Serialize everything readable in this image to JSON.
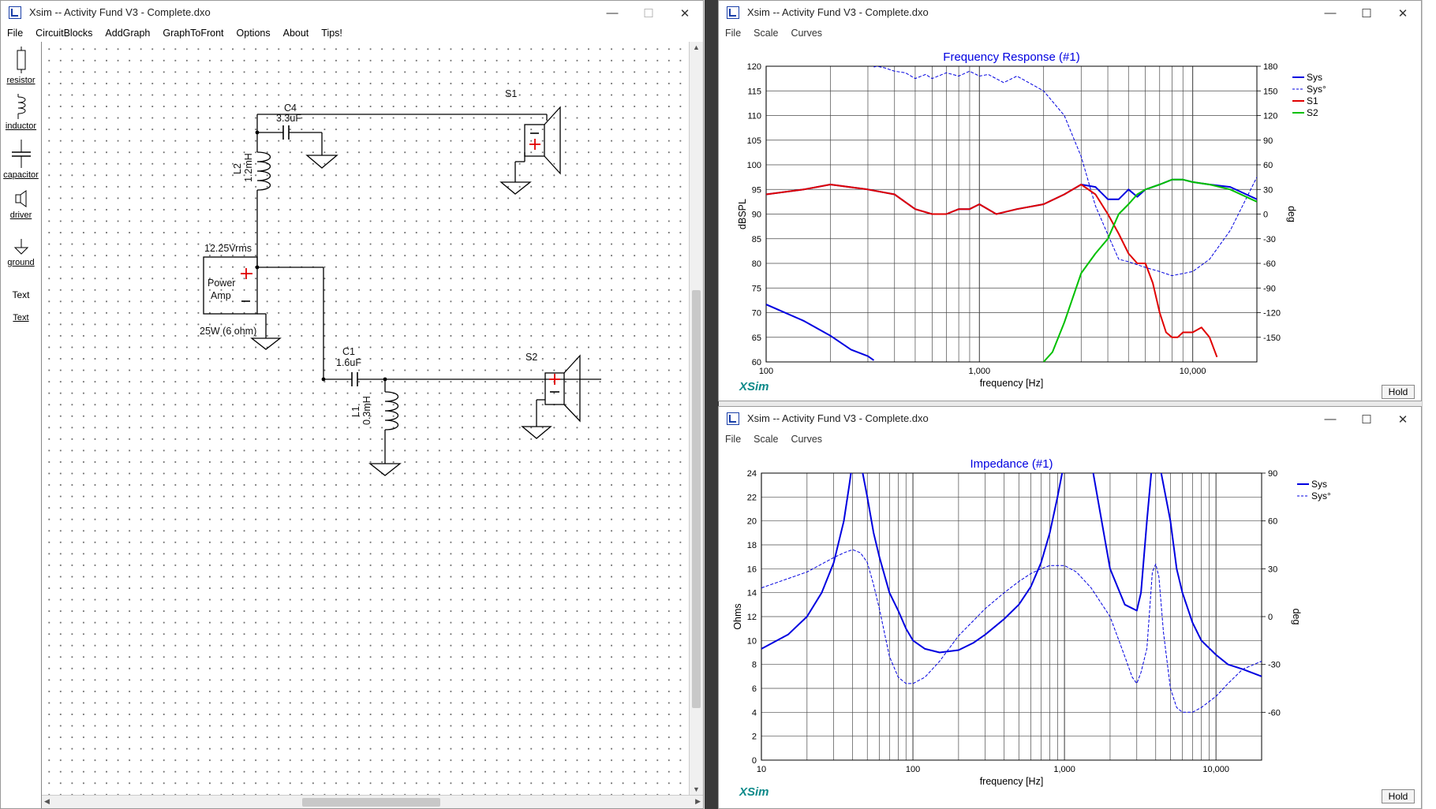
{
  "schematic_window": {
    "title": "Xsim -- Activity Fund V3 - Complete.dxo",
    "menu": [
      "File",
      "CircuitBlocks",
      "AddGraph",
      "GraphToFront",
      "Options",
      "About",
      "Tips!"
    ],
    "tools": [
      "resistor",
      "inductor",
      "capacitor",
      "driver",
      "ground",
      "Text",
      "Text"
    ],
    "components": {
      "c4_name": "C4",
      "c4_value": "3.3uF",
      "l2_name": "L2",
      "l2_value": "1.2mH",
      "c1_name": "C1",
      "c1_value": "1.6uF",
      "l1_name": "L1",
      "l1_value": "0.3mH",
      "s1_name": "S1",
      "s2_name": "S2",
      "amp_voltage": "12.25Vrms",
      "amp_line1": "Power",
      "amp_line2": "Amp",
      "amp_power": "25W (6 ohm)"
    }
  },
  "fr_window": {
    "title": "Xsim -- Activity Fund V3 - Complete.dxo",
    "menu": [
      "File",
      "Scale",
      "Curves"
    ],
    "hold_label": "Hold",
    "logo": "XSim"
  },
  "imp_window": {
    "title": "Xsim -- Activity Fund V3 - Complete.dxo",
    "menu": [
      "File",
      "Scale",
      "Curves"
    ],
    "hold_label": "Hold",
    "logo": "XSim"
  },
  "colors": {
    "sys": "#0000e0",
    "s1": "#e00000",
    "s2": "#00c000",
    "grid": "#4a4a4a",
    "title": "#0000e0",
    "logo": "#0e8a8a"
  },
  "chart_data": [
    {
      "type": "line",
      "title": "Frequency Response (#1)",
      "xlabel": "frequency [Hz]",
      "ylabel": "dBSPL",
      "y2label": "deg",
      "xscale": "log",
      "xlim": [
        100,
        20000
      ],
      "ylim": [
        60,
        120
      ],
      "y2lim": [
        -180,
        180
      ],
      "xticks": [
        {
          "value": 100,
          "label": "100"
        },
        {
          "value": 1000,
          "label": "1,000"
        },
        {
          "value": 10000,
          "label": "10,000"
        }
      ],
      "yticks": [
        60,
        65,
        70,
        75,
        80,
        85,
        90,
        95,
        100,
        105,
        110,
        115,
        120
      ],
      "y2ticks": [
        -150,
        -120,
        -90,
        -60,
        -30,
        0,
        30,
        60,
        90,
        120,
        150,
        180
      ],
      "legend": "top-right",
      "series": [
        {
          "name": "Sys",
          "axis": "left",
          "style": "solid",
          "color": "#0000e0",
          "x": [
            100,
            150,
            200,
            300,
            400,
            500,
            600,
            700,
            800,
            900,
            1000,
            1200,
            1500,
            2000,
            2500,
            3000,
            3500,
            4000,
            4500,
            5000,
            5500,
            6000,
            7000,
            8000,
            9000,
            10000,
            12000,
            15000,
            20000
          ],
          "y": [
            94,
            95,
            96,
            95,
            94,
            91,
            90,
            90,
            91,
            91,
            92,
            90,
            91,
            92,
            94,
            96,
            95.5,
            93,
            93,
            95,
            93.5,
            95,
            96,
            97,
            97,
            96.5,
            96,
            95.5,
            93
          ]
        },
        {
          "name": "Sys°",
          "axis": "right",
          "style": "dashed",
          "color": "#0000e0",
          "x": [
            320,
            330,
            360,
            400,
            450,
            500,
            560,
            600,
            700,
            800,
            900,
            1000,
            1100,
            1300,
            1500,
            2000,
            2500,
            3000,
            3500,
            4000,
            4500,
            5000,
            6000,
            7000,
            8000,
            10000,
            12000,
            15000,
            20000
          ],
          "y": [
            179,
            180,
            178,
            174,
            172,
            165,
            170,
            165,
            172,
            168,
            174,
            168,
            170,
            160,
            168,
            150,
            120,
            70,
            10,
            -25,
            -55,
            -58,
            -65,
            -70,
            -75,
            -70,
            -55,
            -20,
            45
          ]
        },
        {
          "name": "",
          "axis": "right",
          "style": "solid",
          "color": "#0000e0",
          "x": [
            100,
            150,
            200,
            250,
            300,
            320
          ],
          "y": [
            -110,
            -130,
            -148,
            -165,
            -173,
            -178
          ]
        },
        {
          "name": "S1",
          "axis": "left",
          "style": "solid",
          "color": "#e00000",
          "x": [
            100,
            150,
            200,
            300,
            400,
            500,
            600,
            700,
            800,
            900,
            1000,
            1200,
            1500,
            2000,
            2500,
            3000,
            3500,
            4000,
            4500,
            5000,
            5500,
            6000,
            6500,
            7000,
            7500,
            8000,
            8500,
            9000,
            10000,
            11000,
            12000,
            13000
          ],
          "y": [
            94,
            95,
            96,
            95,
            94,
            91,
            90,
            90,
            91,
            91,
            92,
            90,
            91,
            92,
            94,
            96,
            94,
            90,
            86,
            82,
            80,
            80,
            76,
            70,
            66,
            65,
            65,
            66,
            66,
            67,
            65,
            61
          ]
        },
        {
          "name": "S2",
          "axis": "left",
          "style": "solid",
          "color": "#00c000",
          "x": [
            2000,
            2200,
            2500,
            3000,
            3500,
            4000,
            4500,
            5000,
            5500,
            6000,
            7000,
            8000,
            9000,
            10000,
            12000,
            15000,
            20000
          ],
          "y": [
            60,
            62,
            68,
            78,
            82,
            85,
            90,
            92,
            94,
            95,
            96,
            97,
            97,
            96.5,
            96,
            95,
            92.5
          ]
        }
      ]
    },
    {
      "type": "line",
      "title": "Impedance (#1)",
      "xlabel": "frequency [Hz]",
      "ylabel": "Ohms",
      "y2label": "deg",
      "xscale": "log",
      "xlim": [
        10,
        20000
      ],
      "ylim": [
        0,
        24
      ],
      "y2lim": [
        -90,
        90
      ],
      "xticks": [
        {
          "value": 10,
          "label": "10"
        },
        {
          "value": 100,
          "label": "100"
        },
        {
          "value": 1000,
          "label": "1,000"
        },
        {
          "value": 10000,
          "label": "10,000"
        }
      ],
      "yticks": [
        0,
        2,
        4,
        6,
        8,
        10,
        12,
        14,
        16,
        18,
        20,
        22,
        24
      ],
      "y2ticks": [
        -60,
        -30,
        0,
        30,
        60,
        90
      ],
      "legend": "top-right",
      "series": [
        {
          "name": "Sys",
          "axis": "left",
          "style": "solid",
          "color": "#0000e0",
          "x": [
            10,
            15,
            20,
            25,
            30,
            35,
            38,
            40,
            42,
            45,
            50,
            55,
            60,
            70,
            80,
            90,
            100,
            120,
            150,
            200,
            250,
            300,
            400,
            500,
            600,
            700,
            800,
            900,
            1000,
            1100,
            1200,
            1300,
            1500,
            2000,
            2500,
            3000,
            3200,
            3500,
            3800,
            4000,
            4200,
            5000,
            5500,
            6000,
            7000,
            8000,
            10000,
            12000,
            15000,
            20000
          ],
          "y": [
            9.3,
            10.5,
            12,
            14,
            16.5,
            20,
            23,
            25,
            26,
            25,
            22,
            19,
            17,
            14,
            12.5,
            11,
            10,
            9.3,
            9,
            9.2,
            9.8,
            10.5,
            11.8,
            13,
            14.5,
            16.5,
            19,
            22,
            25,
            25,
            25,
            25,
            25,
            16,
            13,
            12.5,
            14,
            20,
            25,
            25,
            25,
            20,
            16,
            14,
            11.5,
            10,
            8.8,
            8,
            7.6,
            7
          ]
        },
        {
          "name": "Sys°",
          "axis": "right",
          "style": "dashed",
          "color": "#0000e0",
          "x": [
            10,
            20,
            30,
            35,
            40,
            45,
            50,
            55,
            60,
            70,
            80,
            90,
            100,
            120,
            150,
            200,
            300,
            400,
            500,
            600,
            700,
            800,
            1000,
            1200,
            1500,
            2000,
            2500,
            2800,
            3000,
            3200,
            3500,
            3800,
            4000,
            4200,
            4500,
            5000,
            5500,
            6000,
            7000,
            8000,
            10000,
            12000,
            15000,
            20000
          ],
          "y": [
            18,
            28,
            37,
            40,
            42,
            40,
            34,
            20,
            5,
            -25,
            -38,
            -42,
            -42,
            -38,
            -28,
            -12,
            5,
            15,
            22,
            27,
            30,
            32,
            32,
            28,
            18,
            0,
            -25,
            -38,
            -42,
            -35,
            -20,
            28,
            33,
            25,
            -10,
            -45,
            -57,
            -60,
            -60,
            -57,
            -50,
            -42,
            -33,
            -28
          ]
        }
      ]
    }
  ]
}
